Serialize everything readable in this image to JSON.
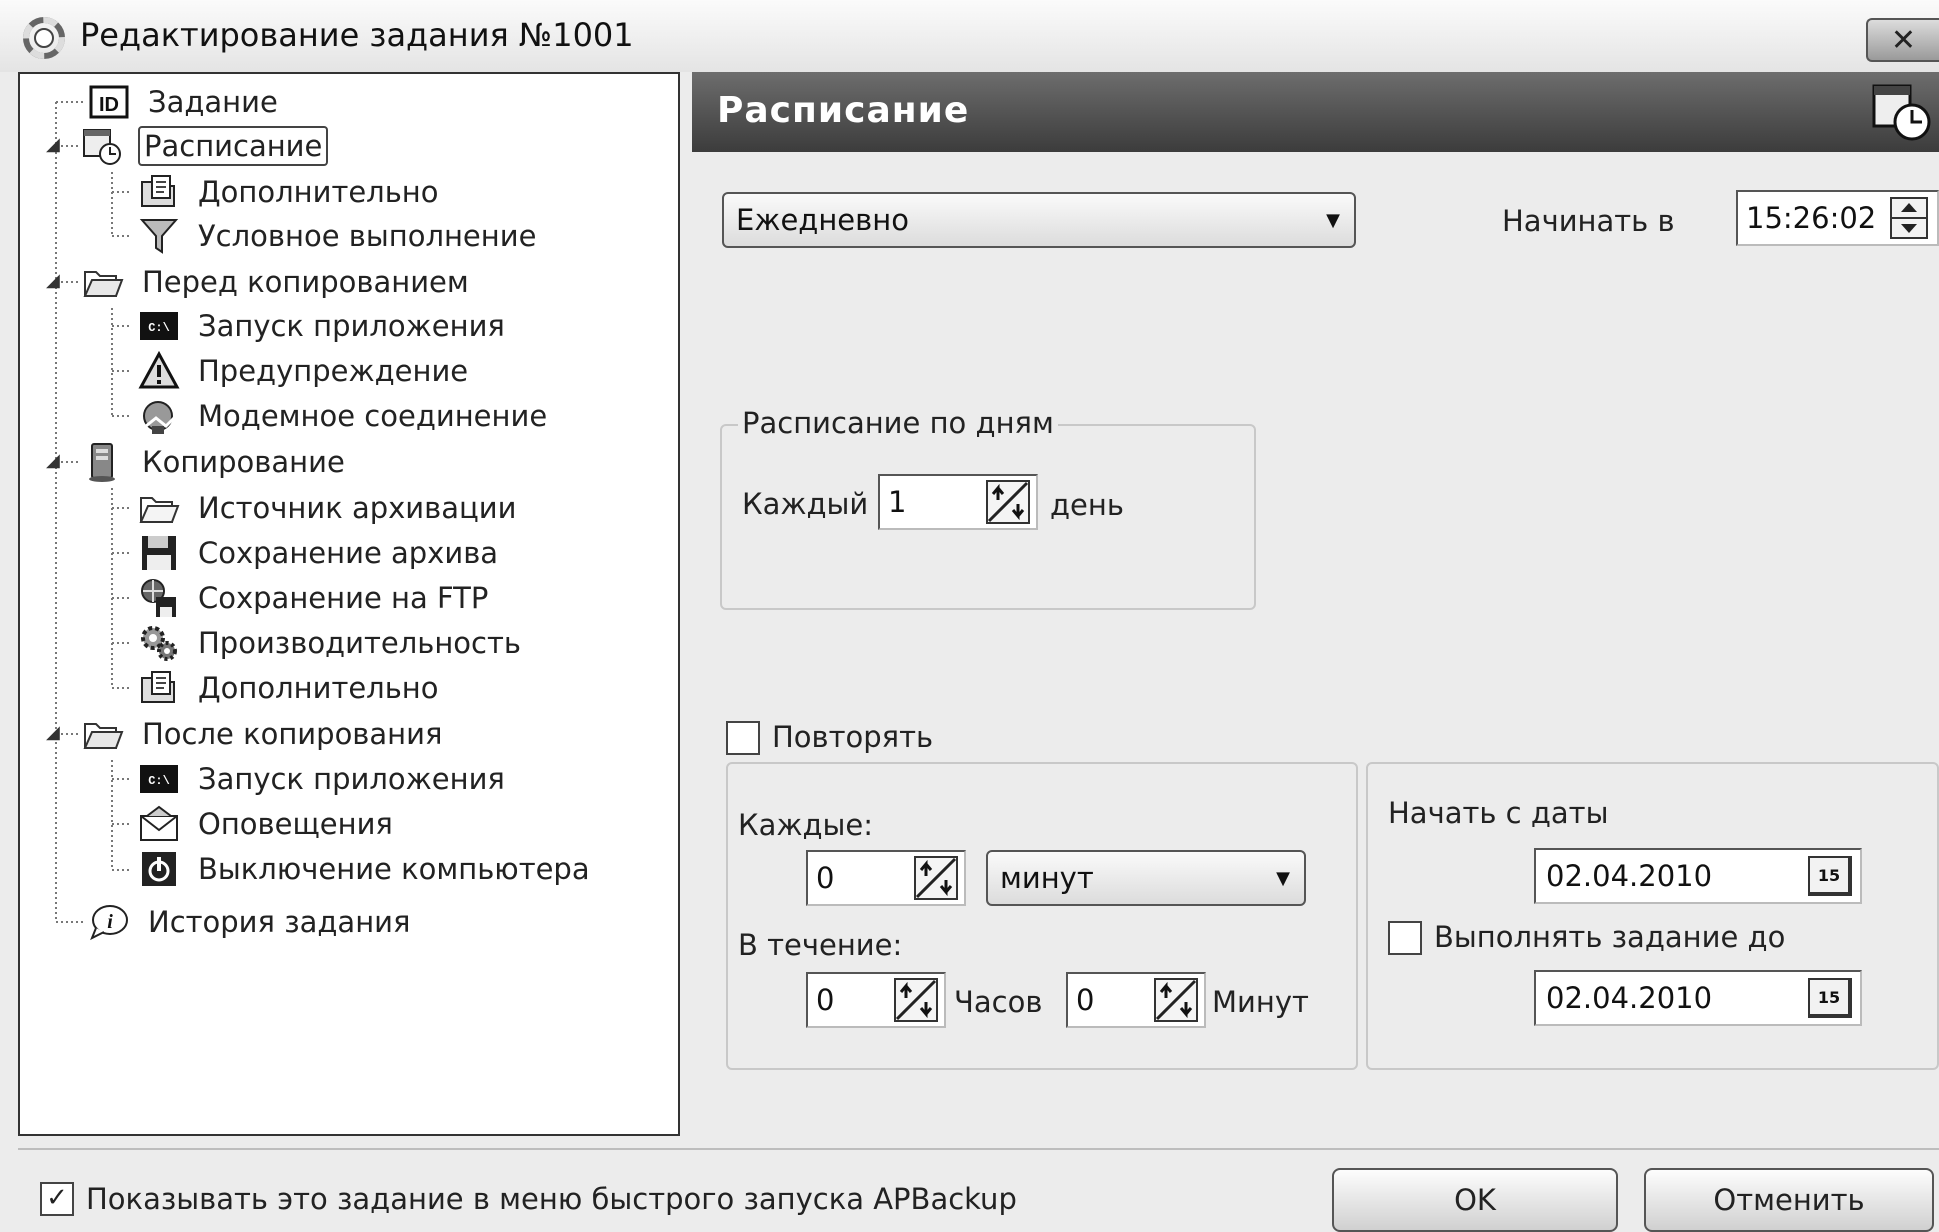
{
  "window": {
    "title": "Редактирование задания №1001",
    "close_label": "✕"
  },
  "tree": {
    "items": [
      {
        "label": "Задание",
        "icon": "id-icon"
      },
      {
        "label": "Расписание",
        "icon": "schedule-icon"
      },
      {
        "label": "Дополнительно",
        "icon": "advanced-icon"
      },
      {
        "label": "Условное выполнение",
        "icon": "filter-icon"
      },
      {
        "label": "Перед копированием",
        "icon": "folder-open-icon"
      },
      {
        "label": "Запуск приложения",
        "icon": "console-icon"
      },
      {
        "label": "Предупреждение",
        "icon": "warning-icon"
      },
      {
        "label": "Модемное соединение",
        "icon": "modem-icon"
      },
      {
        "label": "Копирование",
        "icon": "copy-icon"
      },
      {
        "label": "Источник архивации",
        "icon": "folder-icon"
      },
      {
        "label": "Сохранение архива",
        "icon": "floppy-icon"
      },
      {
        "label": "Сохранение на FTP",
        "icon": "ftp-icon"
      },
      {
        "label": "Производительность",
        "icon": "gears-icon"
      },
      {
        "label": "Дополнительно",
        "icon": "advanced-icon"
      },
      {
        "label": "После копирования",
        "icon": "folder-open-icon"
      },
      {
        "label": "Запуск приложения",
        "icon": "console-icon"
      },
      {
        "label": "Оповещения",
        "icon": "envelope-icon"
      },
      {
        "label": "Выключение компьютера",
        "icon": "power-icon"
      },
      {
        "label": "История задания",
        "icon": "info-icon"
      }
    ]
  },
  "panel": {
    "header": "Расписание",
    "frequency": "Ежедневно",
    "start_at_label": "Начинать в",
    "start_time": "15:26:02",
    "days_group": {
      "title": "Расписание по дням",
      "every_label": "Каждый",
      "every_value": "1",
      "unit_label": "день"
    },
    "repeat": {
      "label": "Повторять",
      "checked": false,
      "every_label": "Каждые:",
      "every_value": "0",
      "every_unit": "минут",
      "during_label": "В течение:",
      "hours_value": "0",
      "hours_label": "Часов",
      "minutes_value": "0",
      "minutes_label": "Минут"
    },
    "dates": {
      "start_label": "Начать с даты",
      "start_date": "02.04.2010",
      "until_label": "Выполнять задание до",
      "until_checked": false,
      "until_date": "02.04.2010",
      "calendar_label": "15"
    }
  },
  "footer": {
    "quick_launch_label": "Показывать это задание в меню быстрого запуска APBackup",
    "quick_launch_checked": true,
    "ok_label": "OK",
    "cancel_label": "Отменить"
  }
}
